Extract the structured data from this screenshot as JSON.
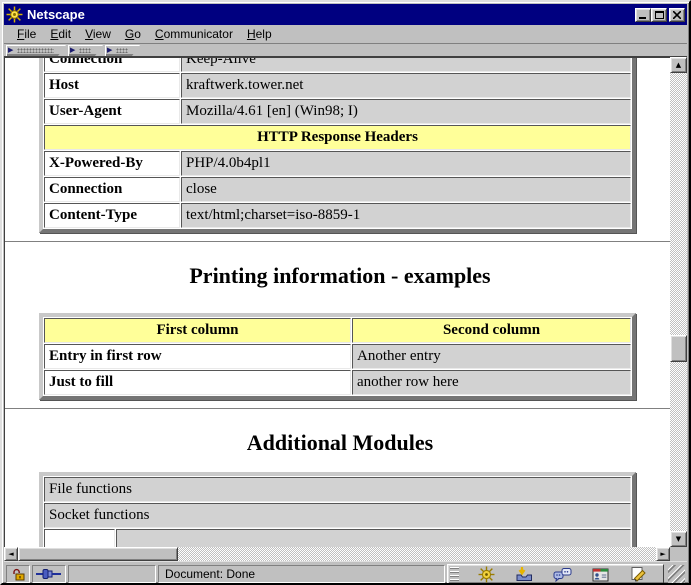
{
  "window": {
    "title": "Netscape"
  },
  "menu": {
    "items": [
      {
        "key": "F",
        "rest": "ile"
      },
      {
        "key": "E",
        "rest": "dit"
      },
      {
        "key": "V",
        "rest": "iew"
      },
      {
        "key": "G",
        "rest": "o"
      },
      {
        "key": "C",
        "rest": "ommunicator"
      },
      {
        "key": "H",
        "rest": "elp"
      }
    ]
  },
  "icons": {
    "toolbar_tab_arrow": "▶",
    "scroll_up": "▲",
    "scroll_down": "▼",
    "scroll_left": "◄",
    "scroll_right": "►"
  },
  "content": {
    "http_request_rows": [
      {
        "label": "Connection",
        "value": "Keep-Alive"
      },
      {
        "label": "Host",
        "value": "kraftwerk.tower.net"
      },
      {
        "label": "User-Agent",
        "value": "Mozilla/4.61 [en] (Win98; I)"
      }
    ],
    "response_header_title": "HTTP Response Headers",
    "http_response_rows": [
      {
        "label": "X-Powered-By",
        "value": "PHP/4.0b4pl1"
      },
      {
        "label": "Connection",
        "value": "close"
      },
      {
        "label": "Content-Type",
        "value": "text/html;charset=iso-8859-1"
      }
    ],
    "printing_heading": "Printing information - examples",
    "printing_table": {
      "col1_header": "First column",
      "col2_header": "Second column",
      "rows": [
        {
          "col1": "Entry in first row",
          "col2": "Another entry"
        },
        {
          "col1": "Just to fill",
          "col2": "another row here"
        }
      ]
    },
    "modules_heading": "Additional Modules",
    "modules_rows": [
      "File functions",
      "Socket functions"
    ]
  },
  "statusbar": {
    "status_text": "Document: Done"
  },
  "colors": {
    "titlebar_blue": "#000080",
    "table_header_yellow": "#ffff99",
    "value_cell_gray": "#d2d2d2",
    "chrome_gray": "#c0c0c0"
  }
}
